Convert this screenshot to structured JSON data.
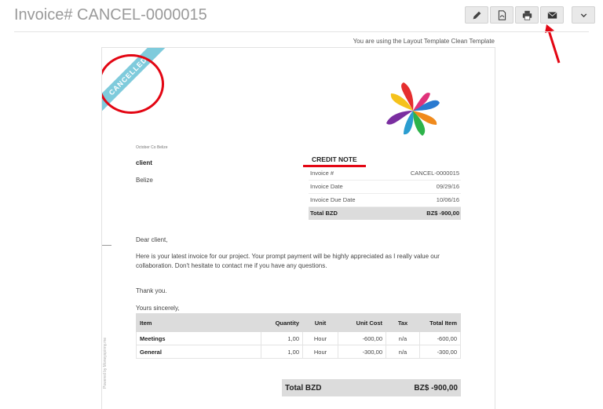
{
  "page": {
    "title": "Invoice# CANCEL-0000015",
    "template_note": "You are using the Layout Template Clean Template"
  },
  "toolbar": {
    "buttons": [
      {
        "icon": "pencil-icon"
      },
      {
        "icon": "pdf-file-icon"
      },
      {
        "icon": "print-icon"
      },
      {
        "icon": "envelope-icon"
      },
      {
        "icon": "chevron-down-icon"
      }
    ]
  },
  "annotation": {
    "circle_color": "#e30613",
    "arrow_color": "#e30613"
  },
  "document": {
    "ribbon": "CANCELLED",
    "ribbon_color": "#7fcbdc",
    "from_company": "October Co Belize",
    "client": {
      "name": "client",
      "country": "Belize"
    },
    "credit_note": {
      "title": "CREDIT NOTE",
      "rows": [
        {
          "label": "Invoice #",
          "value": "CANCEL-0000015"
        },
        {
          "label": "Invoice Date",
          "value": "09/29/16"
        },
        {
          "label": "Invoice Due Date",
          "value": "10/06/16"
        }
      ],
      "total": {
        "label": "Total BZD",
        "value": "BZ$ -900,00"
      }
    },
    "letter": {
      "greeting": "Dear client,",
      "body": "Here is your latest invoice for our project. Your prompt payment will be highly appreciated as I really value our collaboration. Don't hesitate to contact me if you have any questions.",
      "thanks": "Thank you.",
      "closing": "Yours sincerely,"
    },
    "powered_by": "Powered by Moneyspinny.me",
    "items_table": {
      "headers": [
        "Item",
        "Quantity",
        "Unit",
        "Unit Cost",
        "Tax",
        "Total Item"
      ],
      "rows": [
        [
          "Meetings",
          "1,00",
          "Hour",
          "-600,00",
          "n/a",
          "-600,00"
        ],
        [
          "General",
          "1,00",
          "Hour",
          "-300,00",
          "n/a",
          "-300,00"
        ]
      ]
    },
    "grand_total": {
      "label": "Total BZD",
      "value": "BZ$ -900,00"
    }
  }
}
